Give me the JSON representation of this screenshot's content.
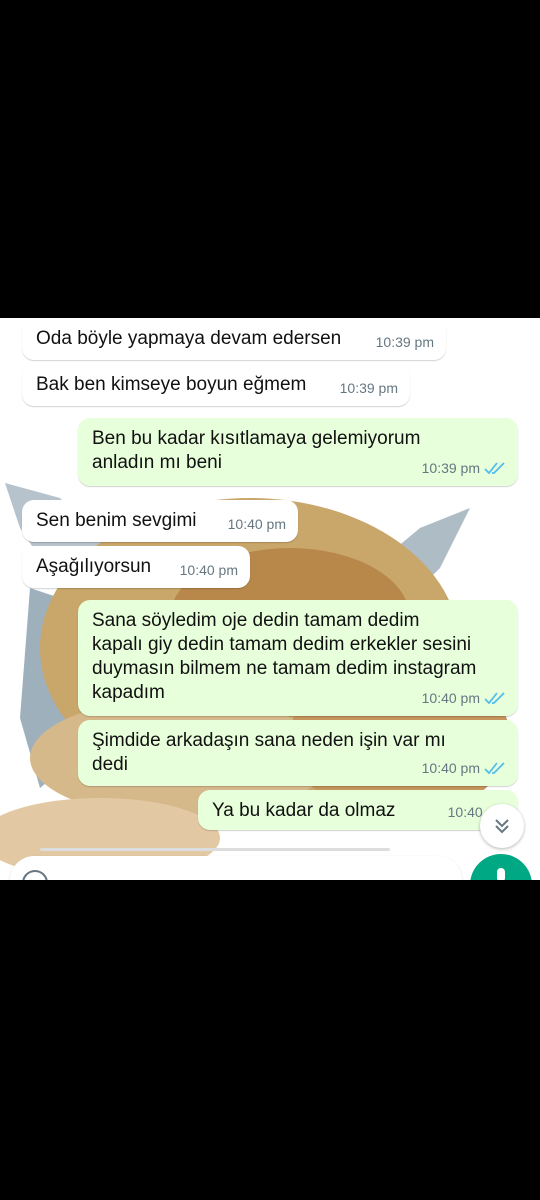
{
  "messages": [
    {
      "dir": "in",
      "text": "Oda böyle yapmaya devam edersen",
      "time": "10:39 pm"
    },
    {
      "dir": "in",
      "text": "Bak ben kimseye boyun eğmem",
      "time": "10:39 pm"
    },
    {
      "dir": "out",
      "text": "Ben bu kadar kısıtlamaya gelemiyorum\nanladın mı beni",
      "time": "10:39 pm"
    },
    {
      "dir": "in",
      "text": "Sen benim sevgimi",
      "time": "10:40 pm"
    },
    {
      "dir": "in",
      "text": "Aşağılıyorsun",
      "time": "10:40 pm"
    },
    {
      "dir": "out",
      "text": "Sana söyledim oje dedin tamam dedim\nkapalı giy dedin tamam dedim erkekler sesini\nduymasın bilmem ne tamam dedim instagram\nkapadım",
      "time": "10:40 pm"
    },
    {
      "dir": "out",
      "text": "Şimdide arkadaşın sana neden işin var mı\ndedi",
      "time": "10:40 pm"
    },
    {
      "dir": "out",
      "text": "Ya bu kadar da olmaz",
      "time": "10:40 pm"
    }
  ],
  "colors": {
    "incoming": "#ffffff",
    "outgoing": "#e7ffdb",
    "read_ticks": "#53bdeb",
    "accent": "#00a884"
  },
  "icons": {
    "scroll_down": "double-chevron-down-icon",
    "read_receipt": "double-check-icon",
    "mic": "mic-icon",
    "emoji": "emoji-icon"
  }
}
